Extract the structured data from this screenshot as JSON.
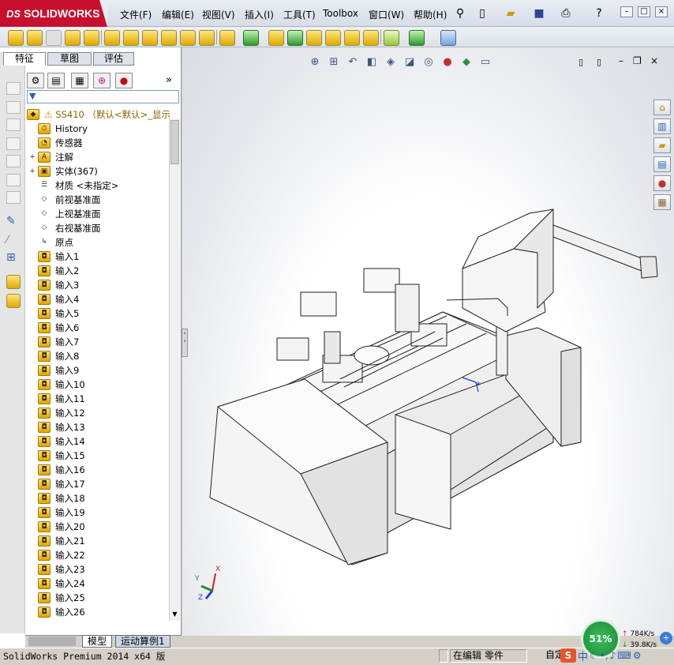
{
  "app": {
    "brand": "SOLIDWORKS",
    "brand_prefix": "DS"
  },
  "menu": [
    "文件(F)",
    "编辑(E)",
    "视图(V)",
    "插入(I)",
    "工具(T)",
    "Toolbox",
    "窗口(W)",
    "帮助(H)"
  ],
  "window_buttons": {
    "minimize": "–",
    "restore": "□",
    "close": "×"
  },
  "left_tabs": [
    "特征",
    "草图",
    "评估"
  ],
  "tree_root": "SS410 （默认<默认>_显示",
  "tree_items": [
    {
      "label": "History",
      "icon": "history-icon",
      "expand": ""
    },
    {
      "label": "传感器",
      "icon": "sensor-icon",
      "expand": ""
    },
    {
      "label": "注解",
      "icon": "annotation-icon",
      "expand": "+"
    },
    {
      "label": "实体(367)",
      "icon": "solid-bodies-icon",
      "expand": "+"
    },
    {
      "label": "材质 <未指定>",
      "icon": "material-icon",
      "expand": ""
    },
    {
      "label": "前视基准面",
      "icon": "plane-icon",
      "expand": ""
    },
    {
      "label": "上视基准面",
      "icon": "plane-icon",
      "expand": ""
    },
    {
      "label": "右视基准面",
      "icon": "plane-icon",
      "expand": ""
    },
    {
      "label": "原点",
      "icon": "origin-icon",
      "expand": ""
    },
    {
      "label": "输入1",
      "icon": "import-icon",
      "expand": ""
    },
    {
      "label": "输入2",
      "icon": "import-icon",
      "expand": ""
    },
    {
      "label": "输入3",
      "icon": "import-icon",
      "expand": ""
    },
    {
      "label": "输入4",
      "icon": "import-icon",
      "expand": ""
    },
    {
      "label": "输入5",
      "icon": "import-icon",
      "expand": ""
    },
    {
      "label": "输入6",
      "icon": "import-icon",
      "expand": ""
    },
    {
      "label": "输入7",
      "icon": "import-icon",
      "expand": ""
    },
    {
      "label": "输入8",
      "icon": "import-icon",
      "expand": ""
    },
    {
      "label": "输入9",
      "icon": "import-icon",
      "expand": ""
    },
    {
      "label": "输入10",
      "icon": "import-icon",
      "expand": ""
    },
    {
      "label": "输入11",
      "icon": "import-icon",
      "expand": ""
    },
    {
      "label": "输入12",
      "icon": "import-icon",
      "expand": ""
    },
    {
      "label": "输入13",
      "icon": "import-icon",
      "expand": ""
    },
    {
      "label": "输入14",
      "icon": "import-icon",
      "expand": ""
    },
    {
      "label": "输入15",
      "icon": "import-icon",
      "expand": ""
    },
    {
      "label": "输入16",
      "icon": "import-icon",
      "expand": ""
    },
    {
      "label": "输入17",
      "icon": "import-icon",
      "expand": ""
    },
    {
      "label": "输入18",
      "icon": "import-icon",
      "expand": ""
    },
    {
      "label": "输入19",
      "icon": "import-icon",
      "expand": ""
    },
    {
      "label": "输入20",
      "icon": "import-icon",
      "expand": ""
    },
    {
      "label": "输入21",
      "icon": "import-icon",
      "expand": ""
    },
    {
      "label": "输入22",
      "icon": "import-icon",
      "expand": ""
    },
    {
      "label": "输入23",
      "icon": "import-icon",
      "expand": ""
    },
    {
      "label": "输入24",
      "icon": "import-icon",
      "expand": ""
    },
    {
      "label": "输入25",
      "icon": "import-icon",
      "expand": ""
    },
    {
      "label": "输入26",
      "icon": "import-icon",
      "expand": ""
    }
  ],
  "bottom_tabs": [
    "模型",
    "运动算例1"
  ],
  "status": {
    "app_version": "SolidWorks Premium 2014 x64 版",
    "mode": "在编辑 零件",
    "custom": "自定"
  },
  "perf": {
    "percent": "51%",
    "up": "784K/s",
    "down": "39.8K/s"
  },
  "triad": {
    "x": "X",
    "y": "Y",
    "z": "Z"
  },
  "colors": {
    "brand_red": "#c8102e",
    "tree_icon": "#f2c200",
    "viewport_bg": "#ffffff"
  }
}
